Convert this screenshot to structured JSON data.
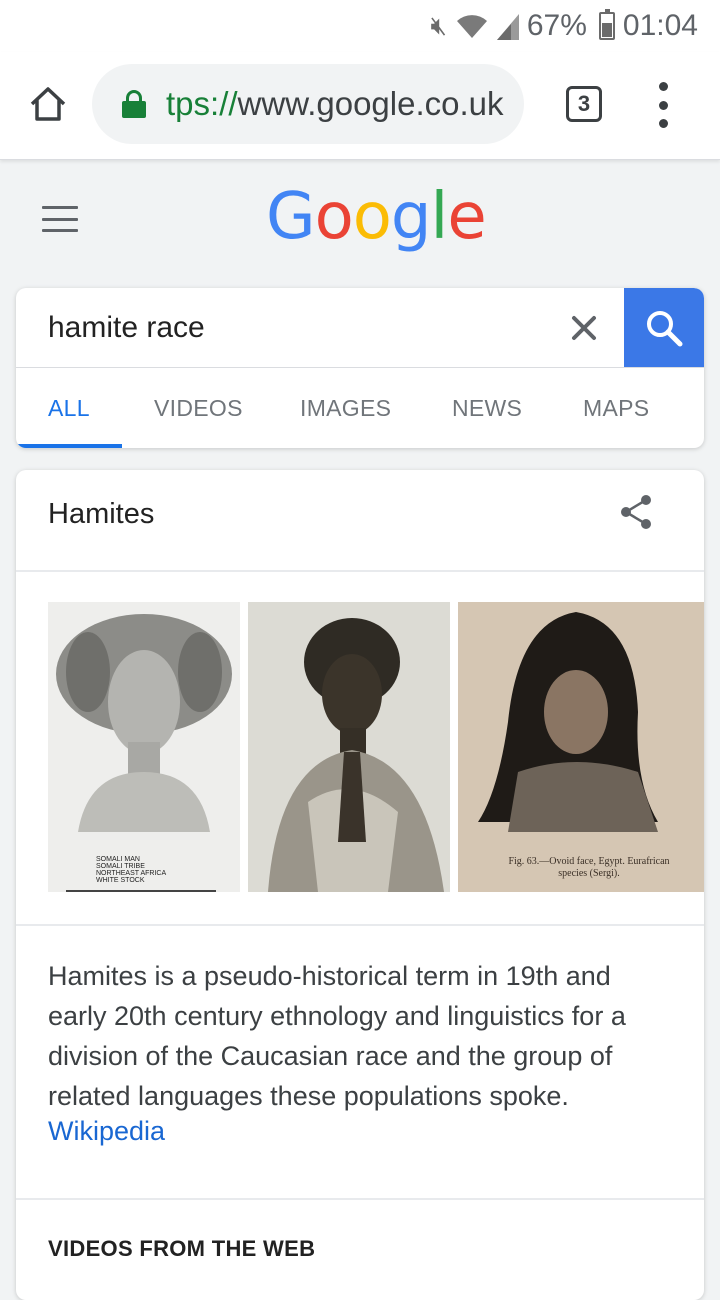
{
  "status_bar": {
    "battery": "67%",
    "time": "01:04"
  },
  "browser": {
    "url_scheme": "tps://",
    "url_host": "www.google.co.uk",
    "tab_count": "3"
  },
  "google": {
    "logo_letters": [
      "G",
      "o",
      "o",
      "g",
      "l",
      "e"
    ],
    "logo_colors": [
      "#4285f4",
      "#ea4335",
      "#fbbc05",
      "#4285f4",
      "#34a853",
      "#ea4335"
    ]
  },
  "search": {
    "query": "hamite race",
    "tabs": [
      {
        "label": "ALL",
        "active": true
      },
      {
        "label": "VIDEOS",
        "active": false
      },
      {
        "label": "IMAGES",
        "active": false
      },
      {
        "label": "NEWS",
        "active": false
      },
      {
        "label": "MAPS",
        "active": false
      }
    ]
  },
  "knowledge_panel": {
    "title": "Hamites",
    "images": [
      {
        "caption_lines": [
          "SOMALI MAN",
          "SOMALI TRIBE",
          "NORTHEAST AFRICA",
          "WHITE STOCK"
        ]
      },
      {
        "caption_lines": []
      },
      {
        "caption_lines": [
          "Fig. 63.—Ovoid face, Egypt.   Eurafrican",
          "species (Sergi)."
        ]
      }
    ],
    "description": "Hamites is a pseudo-historical term in 19th and early 20th century ethnology and linguistics for a division of the Caucasian race and the group of related languages these populations spoke.",
    "source_link": "Wikipedia",
    "videos_heading": "VIDEOS FROM THE WEB"
  },
  "colors": {
    "accent_blue": "#1a73e8",
    "search_button": "#3b78e7",
    "lock_green": "#188038"
  }
}
